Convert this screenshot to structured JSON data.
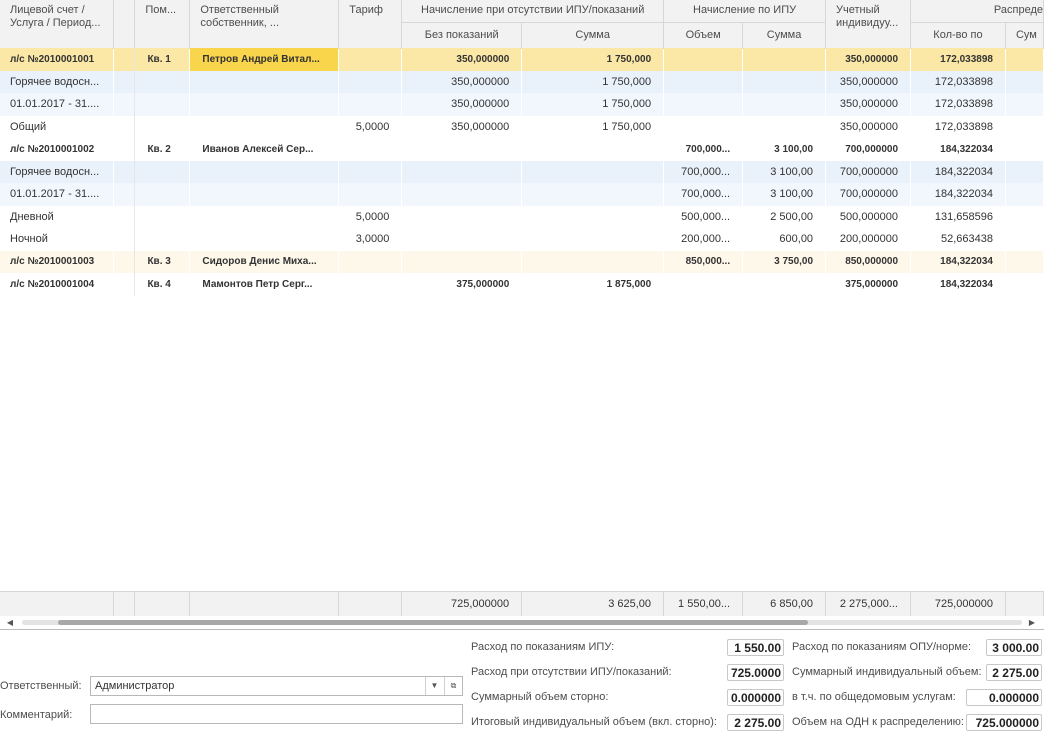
{
  "header": {
    "col_account": "Лицевой счет / Услуга / Период...",
    "col_room": "Пом...",
    "col_owner": "Ответственный собственник, ...",
    "col_tariff": "Тариф",
    "grp_no_meter": "Начисление при отсутствии ИПУ/показаний",
    "sub_no_reading": "Без показаний",
    "sub_sum1": "Сумма",
    "grp_by_meter": "Начисление по ИПУ",
    "sub_volume": "Объем",
    "sub_sum2": "Сумма",
    "col_accounted": "Учетный индивидуу...",
    "grp_distribution": "Распреде",
    "sub_qty": "Кол-во по",
    "sub_sum3": "Сум"
  },
  "rows": [
    {
      "account": "л/с №2010001001",
      "room": "Кв. 1",
      "owner": "Петров Андрей Витал...",
      "tariff": "",
      "no_reading": "350,000000",
      "sum1": "1 750,000",
      "volume": "",
      "sum2": "",
      "accounted": "350,000000",
      "qty": "172,033898"
    },
    {
      "account": "Горячее водосн...",
      "room": "",
      "owner": "",
      "tariff": "",
      "no_reading": "350,000000",
      "sum1": "1 750,000",
      "volume": "",
      "sum2": "",
      "accounted": "350,000000",
      "qty": "172,033898"
    },
    {
      "account": "01.01.2017 - 31....",
      "room": "",
      "owner": "",
      "tariff": "",
      "no_reading": "350,000000",
      "sum1": "1 750,000",
      "volume": "",
      "sum2": "",
      "accounted": "350,000000",
      "qty": "172,033898"
    },
    {
      "account": "Общий",
      "room": "",
      "owner": "",
      "tariff": "5,0000",
      "no_reading": "350,000000",
      "sum1": "1 750,000",
      "volume": "",
      "sum2": "",
      "accounted": "350,000000",
      "qty": "172,033898"
    },
    {
      "account": "л/с №2010001002",
      "room": "Кв. 2",
      "owner": "Иванов Алексей Сер...",
      "tariff": "",
      "no_reading": "",
      "sum1": "",
      "volume": "700,000...",
      "sum2": "3 100,00",
      "accounted": "700,000000",
      "qty": "184,322034"
    },
    {
      "account": "Горячее водосн...",
      "room": "",
      "owner": "",
      "tariff": "",
      "no_reading": "",
      "sum1": "",
      "volume": "700,000...",
      "sum2": "3 100,00",
      "accounted": "700,000000",
      "qty": "184,322034"
    },
    {
      "account": "01.01.2017 - 31....",
      "room": "",
      "owner": "",
      "tariff": "",
      "no_reading": "",
      "sum1": "",
      "volume": "700,000...",
      "sum2": "3 100,00",
      "accounted": "700,000000",
      "qty": "184,322034"
    },
    {
      "account": "Дневной",
      "room": "",
      "owner": "",
      "tariff": "5,0000",
      "no_reading": "",
      "sum1": "",
      "volume": "500,000...",
      "sum2": "2 500,00",
      "accounted": "500,000000",
      "qty": "131,658596"
    },
    {
      "account": "Ночной",
      "room": "",
      "owner": "",
      "tariff": "3,0000",
      "no_reading": "",
      "sum1": "",
      "volume": "200,000...",
      "sum2": "600,00",
      "accounted": "200,000000",
      "qty": "52,663438"
    },
    {
      "account": "л/с №2010001003",
      "room": "Кв. 3",
      "owner": "Сидоров Денис Миха...",
      "tariff": "",
      "no_reading": "",
      "sum1": "",
      "volume": "850,000...",
      "sum2": "3 750,00",
      "accounted": "850,000000",
      "qty": "184,322034"
    },
    {
      "account": "л/с №2010001004",
      "room": "Кв. 4",
      "owner": "Мамонтов Петр Серг...",
      "tariff": "",
      "no_reading": "375,000000",
      "sum1": "1 875,000",
      "volume": "",
      "sum2": "",
      "accounted": "375,000000",
      "qty": "184,322034"
    }
  ],
  "totals": {
    "no_reading": "725,000000",
    "sum1": "3 625,00",
    "volume": "1 550,00...",
    "sum2": "6 850,00",
    "accounted": "2 275,000...",
    "qty": "725,000000"
  },
  "form": {
    "responsible_label": "Ответственный:",
    "responsible_value": "Администратор",
    "comment_label": "Комментарий:",
    "comment_value": ""
  },
  "summary": {
    "ipu_readings_label": "Расход по показаниям ИПУ:",
    "ipu_readings_value": "1 550.00",
    "no_ipu_label": "Расход при отсутствии ИПУ/показаний:",
    "no_ipu_value": "725.0000",
    "storno_label": "Суммарный объем сторно:",
    "storno_value": "0.000000",
    "total_individual_label": "Итоговый индивидуальный объем (вкл. сторно):",
    "total_individual_value": "2 275.00",
    "opu_label": "Расход по показаниям ОПУ/норме:",
    "opu_value": "3 000.00",
    "sum_individual_label": "Суммарный индивидуальный объем:",
    "sum_individual_value": "2 275.00",
    "common_services_label": "в т.ч. по общедомовым услугам:",
    "common_services_value": "0.000000",
    "odn_label": "Объем на ОДН к распределению:",
    "odn_value": "725.000000"
  },
  "colors": {
    "selected_row": "#fbe8a6",
    "selected_cell": "#f9d54b",
    "child_row": "#e9f1fb",
    "header_bg": "#f2f2f2"
  }
}
